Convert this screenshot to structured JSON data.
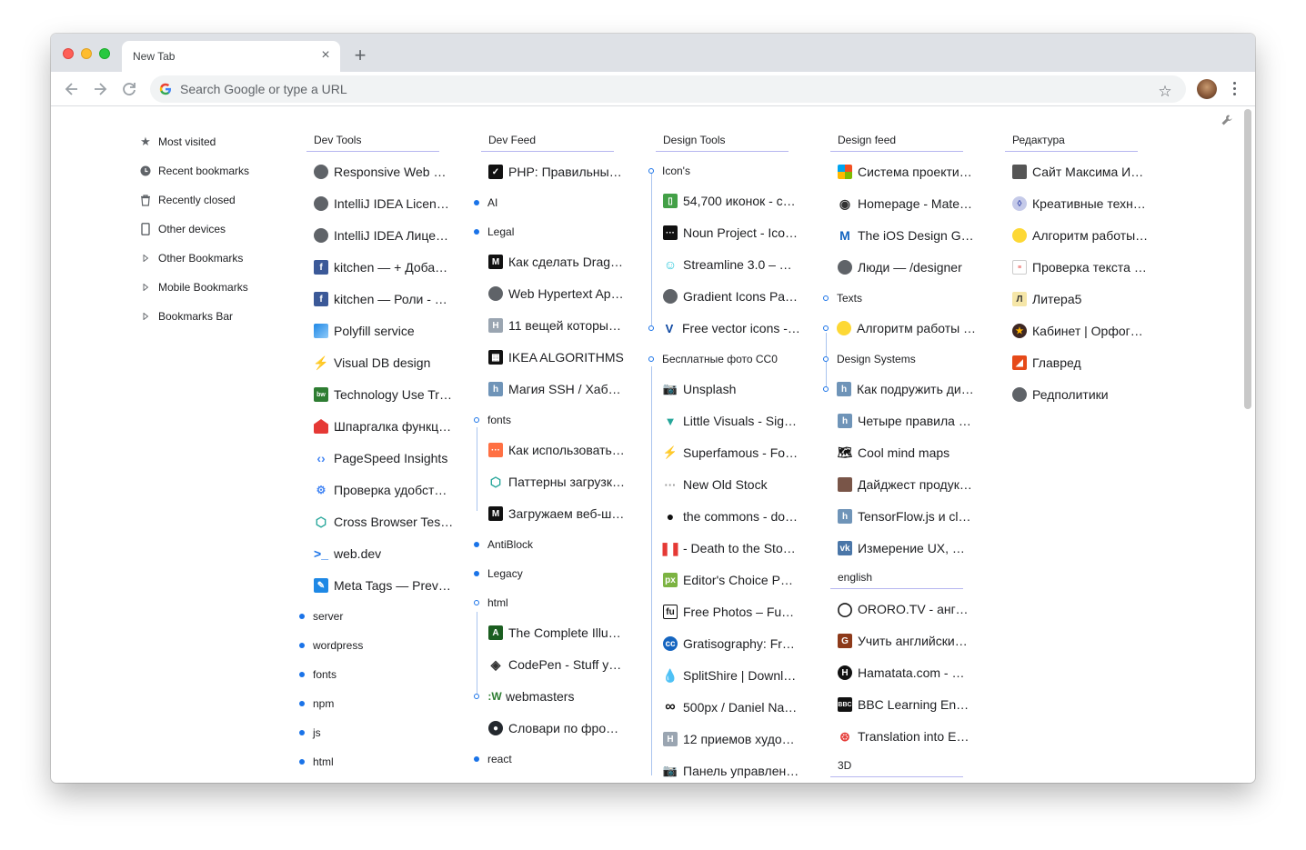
{
  "tab": {
    "title": "New Tab",
    "close": "×",
    "new": "+"
  },
  "omnibox": {
    "placeholder": "Search Google or type a URL"
  },
  "sidebar": [
    {
      "label": "Most visited",
      "icon": "star-icon"
    },
    {
      "label": "Recent bookmarks",
      "icon": "clock-icon"
    },
    {
      "label": "Recently closed",
      "icon": "trash-icon"
    },
    {
      "label": "Other devices",
      "icon": "phone-icon"
    },
    {
      "label": "Other Bookmarks",
      "icon": "triangle-right-icon"
    },
    {
      "label": "Mobile Bookmarks",
      "icon": "triangle-right-icon"
    },
    {
      "label": "Bookmarks Bar",
      "icon": "triangle-right-icon"
    }
  ],
  "columns": {
    "dev_tools": {
      "header": "Dev Tools",
      "items": [
        "Responsive Web …",
        "IntelliJ IDEA Licen…",
        "IntelliJ IDEA Лице…",
        "kitchen — + Доба…",
        "kitchen — Роли - …",
        "Polyfill service",
        "Visual DB design",
        "Technology Use Tr…",
        "Шпаргалка функц…",
        "PageSpeed Insights",
        "Проверка удобст…",
        "Cross Browser Tes…",
        "web.dev",
        "Meta Tags — Prev…"
      ],
      "folders": [
        "server",
        "wordpress",
        "fonts",
        "npm",
        "js",
        "html"
      ]
    },
    "dev_feed": {
      "header": "Dev Feed",
      "item0": "PHP: Правильный…",
      "folder_ai": "AI",
      "folder_legal": "Legal",
      "legal_items": [
        "Как сделать Drag…",
        "Web Hypertext Ap…",
        "11 вещей которы…",
        "IKEA ALGORITHMS",
        "Магия SSH / Хабр…"
      ],
      "folder_fonts": "fonts",
      "fonts_items": [
        "Как использовать…",
        "Паттерны загрузк…",
        "Загружаем веб-ш…"
      ],
      "folder_antiblock": "AntiBlock",
      "folder_legacy": "Legacy",
      "folder_html": "html",
      "html_items": [
        "The Complete Illu…",
        "CodePen - Stuff y…"
      ],
      "folder_webmasters": "webmasters",
      "webmasters_items": [
        "Словари по фрон…"
      ],
      "folder_react": "react"
    },
    "design_tools": {
      "header": "Design Tools",
      "folder_icons": "Icon's",
      "icons_items": [
        "54,700 иконок - c…",
        "Noun Project - Ico…",
        "Streamline 3.0 – T…",
        "Gradient Icons Pa…"
      ],
      "item_free_vector": "Free vector icons -…",
      "folder_photos": "Бесплатные фото CC0",
      "photos_items": [
        "Unsplash",
        "Little Visuals - Sig…",
        "Superfamous - Fol…",
        "New Old Stock",
        "the commons - do…",
        "- Death to the Sto…",
        "Editor's Choice Ph…",
        "Free Photos – Fun…",
        "Gratisography: Fr…",
        "SplitShire | Downlo…",
        "500px / Daniel Na…",
        "12 приемов худо…"
      ],
      "item_panel": "Панель управления"
    },
    "design_feed": {
      "header": "Design feed",
      "items": [
        "Система проекти…",
        "Homepage - Mate…",
        "The iOS Design G…",
        "Люди — /designer"
      ],
      "folder_texts": "Texts",
      "texts_items": [
        "Алгоритм работы …"
      ],
      "folder_ds": "Design Systems",
      "ds_items": [
        "Как подружить ди…",
        "Четыре правила и…",
        "Cool mind maps",
        "Дайджест продук…",
        "TensorFlow.js и cl…",
        "Измерение UX, №…"
      ],
      "header_english": "english",
      "english_items": [
        "ORORO.TV - англ…",
        "Учить английский…",
        "Hamatata.com - Ф…",
        "BBC Learning En…",
        "Translation into En…"
      ],
      "header_3d": "3D"
    },
    "redaktura": {
      "header": "Редактура",
      "items": [
        "Сайт Максима Ил…",
        "Креативные техн…",
        "Алгоритм работы …",
        "Проверка текста …",
        "Литера5",
        "Кабинет | Орфогр…",
        "Главред",
        "Редполитики"
      ]
    }
  }
}
